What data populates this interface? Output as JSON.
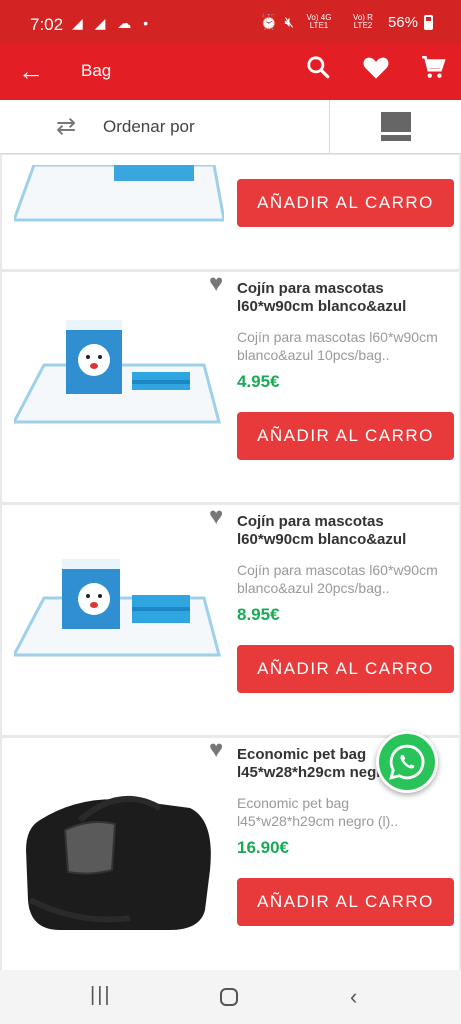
{
  "status_bar": {
    "time": "7:02",
    "icons_left": "◢ ◢ ☁ •",
    "signal_1": "Vo) 4G LTE1",
    "signal_2": "Vo) R LTE2",
    "battery": "56%"
  },
  "app_bar": {
    "title": "Bag",
    "back_icon": "arrow-left-icon",
    "search_icon": "search-icon",
    "favorites_icon": "heart-icon",
    "cart_icon": "cart-icon"
  },
  "sort_bar": {
    "sort_label": "Ordenar por",
    "view_toggle_icon": "list-view-icon"
  },
  "products": [
    {
      "name_line1": "",
      "name_line2": "",
      "desc_line1": "",
      "desc_line2": "",
      "price": "",
      "button_label": "AÑADIR AL CARRO"
    },
    {
      "name_line1": "Cojín para mascotas",
      "name_line2": "l60*w90cm blanco&azul",
      "desc_line1": "Cojín para mascotas l60*w90cm",
      "desc_line2": "blanco&azul 10pcs/bag..",
      "price": "4.95€",
      "button_label": "AÑADIR AL CARRO"
    },
    {
      "name_line1": "Cojín para mascotas",
      "name_line2": "l60*w90cm blanco&azul",
      "desc_line1": "Cojín para mascotas l60*w90cm",
      "desc_line2": "blanco&azul 20pcs/bag..",
      "price": "8.95€",
      "button_label": "AÑADIR AL CARRO"
    },
    {
      "name_line1": "Economic pet bag",
      "name_line2": "l45*w28*h29cm negro",
      "desc_line1": "Economic pet bag",
      "desc_line2": "l45*w28*h29cm negro (l)..",
      "price": "16.90€",
      "button_label": "AÑADIR AL CARRO"
    }
  ],
  "colors": {
    "brand_red": "#e31e24",
    "button_red": "#e83a3a",
    "price_green": "#1aaa55",
    "whatsapp_green": "#28c45a"
  },
  "floating": {
    "whatsapp_icon": "whatsapp-icon"
  }
}
